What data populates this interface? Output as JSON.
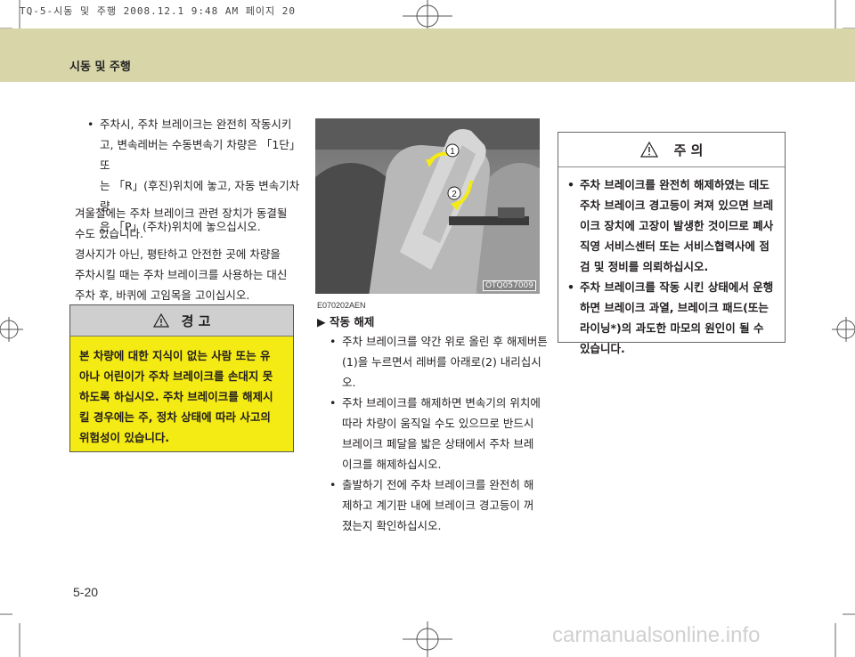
{
  "print_header": "TQ-5-시동 및 주행 2008.12.1 9:48 AM 페이지 20",
  "section_title": "시동 및 주행",
  "left_column": {
    "bullet_lines": [
      "주차시, 주차 브레이크는 완전히 작동시키",
      "고, 변속레버는 수동변속기 차량은 「1단」 또",
      "는 「R」(후진)위치에 놓고, 자동 변속기차량",
      "은 「P」(주차)위치에 놓으십시오."
    ],
    "paragraph1": [
      "겨울철에는 주차 브레이크 관련 장치가 동결될",
      "수도 있습니다."
    ],
    "paragraph2": [
      "경사지가 아닌, 평탄하고 안전한 곳에 차량을",
      "주차시킬 때는 주차 브레이크를 사용하는 대신",
      "주차 후, 바퀴에 고임목을 고이십시오."
    ]
  },
  "warning": {
    "title": "경   고",
    "icon": "warning-triangle-icon",
    "lines": [
      "본 차량에 대한 지식이 없는 사람 또는 유",
      "아나 어린이가 주차 브레이크를 손대지 못",
      "하도록 하십시오. 주차 브레이크를 해제시",
      "킬 경우에는 주, 정차 상태에 따라 사고의",
      "위험성이 있습니다."
    ],
    "bg_color": "#f4ea14"
  },
  "photo": {
    "code": "OTQ057009",
    "label_1": "1",
    "label_2": "2"
  },
  "middle_column": {
    "code_line": "E070202AEN",
    "subheading": "▶ 작동 해제",
    "bullets": [
      [
        "주차 브레이크를 약간 위로 올린 후 해제버튼",
        "(1)을 누르면서 레버를 아래로(2) 내리십시오."
      ],
      [
        "주차 브레이크를 해제하면 변속기의 위치에",
        "따라 차량이 움직일 수도 있으므로 반드시",
        "브레이크 페달을 밟은 상태에서 주차 브레",
        "이크를 해제하십시오."
      ],
      [
        "출발하기 전에 주차 브레이크를 완전히 해",
        "제하고 계기판 내에 브레이크 경고등이 꺼",
        "졌는지 확인하십시오."
      ]
    ]
  },
  "caution": {
    "title": "주   의",
    "icon": "warning-triangle-icon",
    "bullets": [
      [
        "주차 브레이크를 완전히 해제하였는 데도",
        "주차 브레이크 경고등이 켜져 있으면 브레",
        "이크 장치에 고장이 발생한 것이므로 폐사",
        "직영 서비스센터 또는 서비스협력사에 점",
        "검 및 정비를 의뢰하십시오."
      ],
      [
        "주차 브레이크를 작동 시킨 상태에서 운행",
        "하면 브레이크 과열, 브레이크 패드(또는",
        "라이닝*)의 과도한 마모의 원인이 될 수",
        "있습니다."
      ]
    ]
  },
  "page_number": "5-20",
  "watermark": "carmanualsonline.info"
}
